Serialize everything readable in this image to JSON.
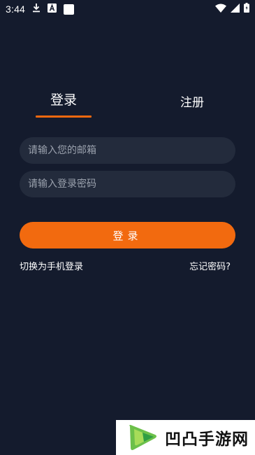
{
  "status_bar": {
    "time": "3:44",
    "icons": [
      "download-icon",
      "font-a-icon",
      "white-square-icon",
      "wifi-icon",
      "signal-icon",
      "battery-icon"
    ]
  },
  "tabs": {
    "login": "登录",
    "register": "注册",
    "active": "login"
  },
  "form": {
    "email_placeholder": "请输入您的邮箱",
    "password_placeholder": "请输入登录密码",
    "login_button": "登录"
  },
  "links": {
    "phone_login": "切换为手机登录",
    "forgot_password": "忘记密码?"
  },
  "watermark": {
    "text": "凹凸手游网"
  },
  "colors": {
    "background": "#141b2d",
    "accent": "#f26a0f",
    "input_bg": "#232b3c",
    "placeholder": "#9aa1ad"
  }
}
